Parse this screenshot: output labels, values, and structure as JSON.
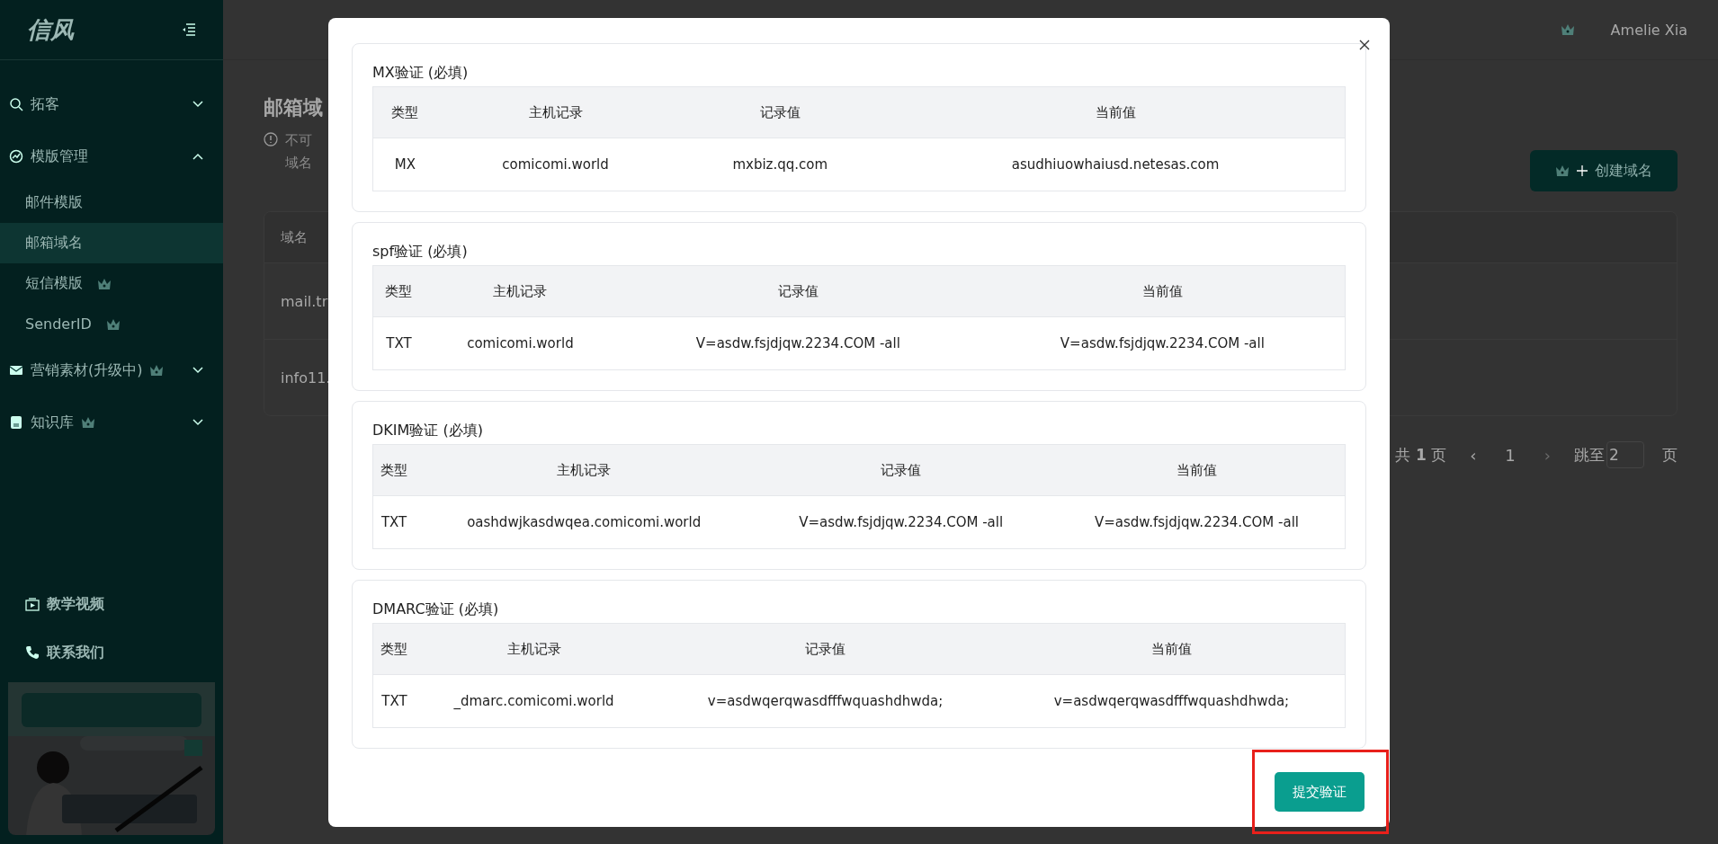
{
  "sidebar": {
    "logo": "信风",
    "items": [
      {
        "label": "拓客",
        "expanded": false,
        "crown": false
      },
      {
        "label": "模版管理",
        "expanded": true,
        "crown": false,
        "children": [
          {
            "label": "邮件模版",
            "selected": false,
            "crown": false
          },
          {
            "label": "邮箱域名",
            "selected": true,
            "crown": false
          },
          {
            "label": "短信模版",
            "selected": false,
            "crown": true
          },
          {
            "label": "SenderID",
            "selected": false,
            "crown": true
          }
        ]
      },
      {
        "label": "营销素材(升级中)",
        "expanded": false,
        "crown": true
      },
      {
        "label": "知识库",
        "expanded": false,
        "crown": true
      }
    ],
    "links": [
      "教学视频",
      "联系我们"
    ]
  },
  "header": {
    "user": "Amelie Xia"
  },
  "page": {
    "title": "邮箱域",
    "notice": [
      "不可",
      "域名"
    ],
    "create_button": "创建域名",
    "table": {
      "columns": [
        "域名"
      ],
      "rows": [
        "mail.tr",
        "info11."
      ]
    },
    "pagination": {
      "total_prefix": "共",
      "total": "1",
      "total_suffix": "页",
      "prev": "‹",
      "current": "1",
      "next": "›",
      "jump_label": "跳至",
      "jump_value": "2",
      "jump_suffix": "页"
    }
  },
  "dialog": {
    "sections": [
      {
        "title": "MX验证 (必填)",
        "columns": [
          "类型",
          "主机记录",
          "记录值",
          "当前值"
        ],
        "row": [
          "MX",
          "comicomi.world",
          "mxbiz.qq.com",
          "asudhiuowhaiusd.netesas.com"
        ]
      },
      {
        "title": "spf验证 (必填)",
        "columns": [
          "类型",
          "主机记录",
          "记录值",
          "当前值"
        ],
        "row": [
          "TXT",
          "comicomi.world",
          "V=asdw.fsjdjqw.2234.COM -all",
          "V=asdw.fsjdjqw.2234.COM -all"
        ]
      },
      {
        "title": "DKIM验证 (必填)",
        "columns": [
          "类型",
          "主机记录",
          "记录值",
          "当前值"
        ],
        "row": [
          "TXT",
          "oashdwjkasdwqea.comicomi.world",
          "V=asdw.fsjdjqw.2234.COM -all",
          "V=asdw.fsjdjqw.2234.COM -all"
        ]
      },
      {
        "title": "DMARC验证 (必填)",
        "columns": [
          "类型",
          "主机记录",
          "记录值",
          "当前值"
        ],
        "row": [
          "TXT",
          "_dmarc.comicomi.world",
          "v=asdwqerqwasdfffwquashdhwda;",
          "v=asdwqerqwasdfffwquashdhwda;"
        ]
      }
    ],
    "submit": "提交验证",
    "submit_highlighted": true
  }
}
